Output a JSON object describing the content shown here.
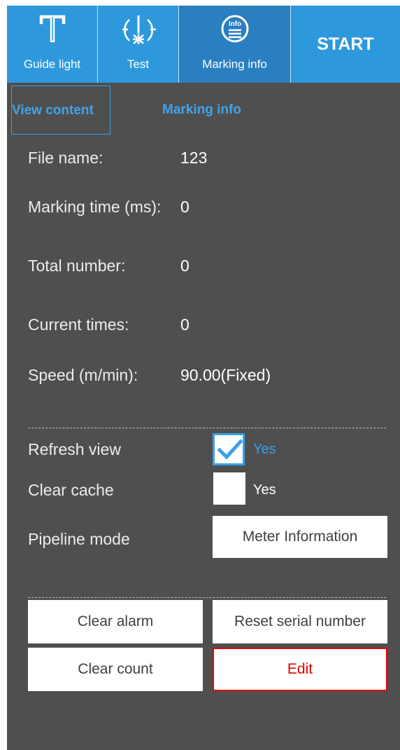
{
  "toolbar": {
    "guide_light": {
      "label": "Guide light",
      "icon": "guide-light-icon"
    },
    "test": {
      "label": "Test",
      "icon": "test-laser-icon"
    },
    "marking_info": {
      "label": "Marking info",
      "icon": "info-icon"
    },
    "start": {
      "label": "START"
    }
  },
  "tabs": {
    "view_content": "View content",
    "marking_info": "Marking info"
  },
  "info": {
    "file_name": {
      "label": "File name:",
      "value": "123"
    },
    "marking_time": {
      "label": "Marking time (ms):",
      "value": "0"
    },
    "total_number": {
      "label": "Total number:",
      "value": "0"
    },
    "current_times": {
      "label": "Current times:",
      "value": "0"
    },
    "speed": {
      "label": "Speed (m/min):",
      "value": "90.00(Fixed)"
    }
  },
  "options": {
    "refresh_view": {
      "label": "Refresh view",
      "checked": true,
      "yes_label": "Yes"
    },
    "clear_cache": {
      "label": "Clear cache",
      "checked": false,
      "yes_label": "Yes"
    },
    "pipeline_mode": {
      "label": "Pipeline mode",
      "button": "Meter Information"
    }
  },
  "actions": {
    "clear_alarm": "Clear alarm",
    "reset_serial": "Reset serial number",
    "clear_count": "Clear count",
    "edit": "Edit"
  },
  "colors": {
    "toolbar_blue": "#2e98dd",
    "toolbar_active": "#2a7fc0",
    "panel_bg": "#4f4f4f",
    "accent_blue": "#3fa4ea",
    "edit_red": "#e00000"
  }
}
